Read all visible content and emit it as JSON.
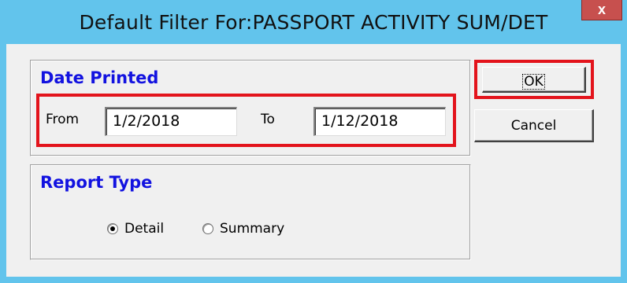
{
  "window": {
    "title": "Default Filter For:PASSPORT ACTIVITY SUM/DET",
    "close_glyph": "x",
    "frame_color": "#62c4ec"
  },
  "date_printed": {
    "title": "Date Printed",
    "from_label": "From",
    "from_value": "1/2/2018",
    "to_label": "To",
    "to_value": "1/12/2018"
  },
  "report_type": {
    "title": "Report Type",
    "options": [
      {
        "label": "Detail",
        "selected": true
      },
      {
        "label": "Summary",
        "selected": false
      }
    ]
  },
  "buttons": {
    "ok_label": "OK",
    "cancel_label": "Cancel"
  },
  "highlight_color": "#e3141c",
  "group_title_color": "#1212e0"
}
